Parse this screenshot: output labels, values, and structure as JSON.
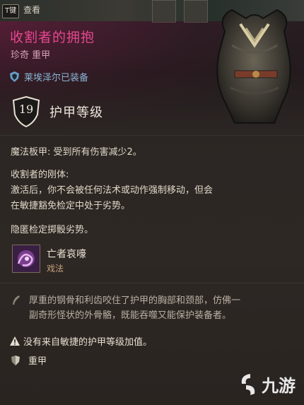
{
  "hud": {
    "key_hint": "T键",
    "view_label": "查看"
  },
  "item": {
    "name": "收割者的拥抱",
    "rarity_type": "珍奇 重甲",
    "equipped_by": "莱埃泽尔已装备",
    "armor_class": "19",
    "armor_class_label": "护甲等级"
  },
  "effects": {
    "magic_plate": "魔法板甲: 受到所有伤害减少2。",
    "reaper_title": "收割者的刚体:",
    "reaper_desc_1": "激活后，你不会被任何法术或动作强制移动，但会",
    "reaper_desc_2": "在敏捷豁免检定中处于劣势。",
    "stealth": "隐匿检定掷骰劣势。"
  },
  "spell": {
    "name": "亡者哀嚎",
    "type": "戏法",
    "icon": "spell-wail-icon"
  },
  "flavor": {
    "line1": "厚重的钢骨和利齿咬住了护甲的胸部和颈部，仿佛一",
    "line2": "副奇形怪状的外骨骼，既能吞噬又能保护装备者。"
  },
  "notes": {
    "no_dex": "没有来自敏捷的护甲等级加值。",
    "proficiency": "重甲"
  },
  "watermark": {
    "text": "九游"
  },
  "colors": {
    "title": "#e6478f",
    "equipped": "#8ab6d6",
    "spell_type": "#c9a37a"
  }
}
